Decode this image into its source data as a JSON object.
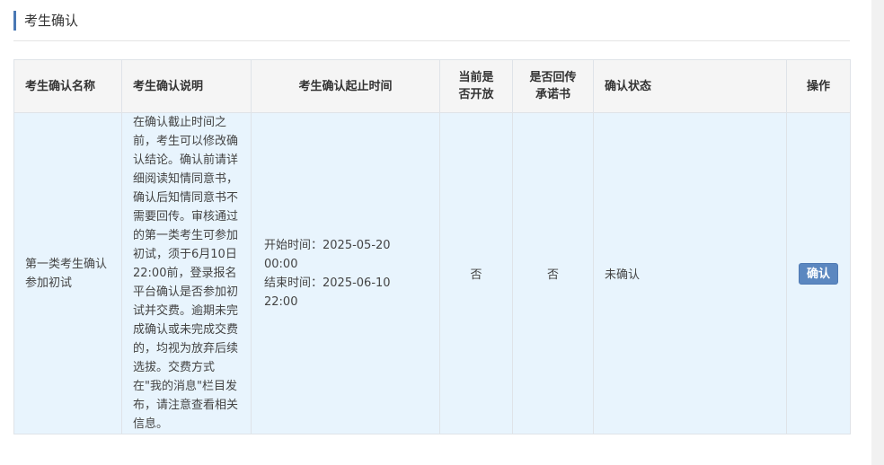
{
  "section": {
    "title": "考生确认"
  },
  "table": {
    "headers": {
      "name": "考生确认名称",
      "description": "考生确认说明",
      "period": "考生确认起止时间",
      "open_line1": "当前是",
      "open_line2": "否开放",
      "promise_line1": "是否回传",
      "promise_line2": "承诺书",
      "status": "确认状态",
      "action": "操作"
    },
    "rows": [
      {
        "name": "第一类考生确认参加初试",
        "description": "在确认截止时间之前，考生可以修改确认结论。确认前请详细阅读知情同意书，确认后知情同意书不需要回传。审核通过的第一类考生可参加初试，须于6月10日22:00前，登录报名平台确认是否参加初试并交费。逾期未完成确认或未完成交费的，均视为放弃后续选拔。交费方式在\"我的消息\"栏目发布，请注意查看相关信息。",
        "start_time": "开始时间：2025-05-20 00:00",
        "end_time": "结束时间：2025-06-10 22:00",
        "is_open": "否",
        "promise_returned": "否",
        "status": "未确认",
        "action_label": "确认"
      }
    ]
  },
  "colors": {
    "accent": "#4a78b4",
    "header_bg": "#f5f5f5",
    "row_bg": "#e8f4fd",
    "button_bg": "#5b87c0"
  }
}
